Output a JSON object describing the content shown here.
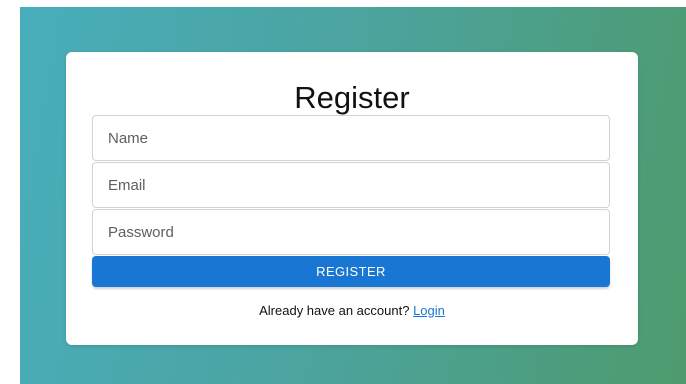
{
  "form": {
    "title": "Register",
    "name_placeholder": "Name",
    "email_placeholder": "Email",
    "password_placeholder": "Password",
    "submit_label": "REGISTER",
    "login_prompt": "Already have an account?",
    "login_link": "Login"
  },
  "colors": {
    "accent": "#1976d2",
    "background_gradient": [
      "#48aebb",
      "#4e9b6e"
    ],
    "card": "#ffffff"
  }
}
